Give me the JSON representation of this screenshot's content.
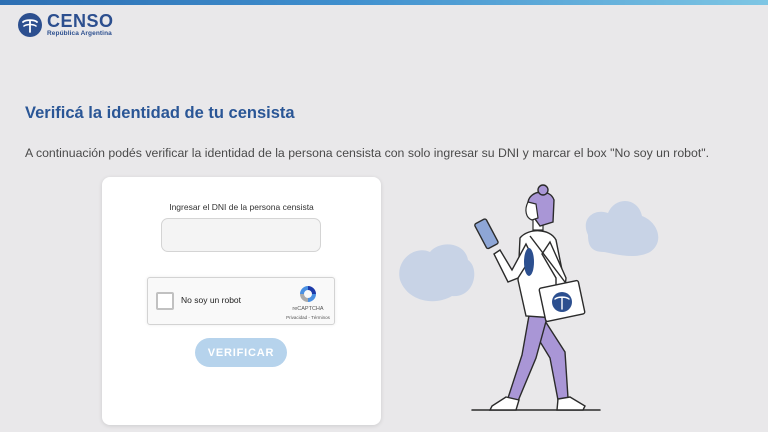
{
  "brand": {
    "name": "CENSO",
    "subtitle": "República Argentina",
    "color": "#2c4f8f"
  },
  "page": {
    "title": "Verificá la identidad de tu censista",
    "description": "A continuación podés verificar la identidad de la persona censista con solo ingresar su DNI y marcar el box \"No soy un robot\"."
  },
  "form": {
    "dni_label": "Ingresar el DNI de la persona censista",
    "dni_value": "",
    "recaptcha": {
      "label": "No soy un robot",
      "brand": "reCAPTCHA",
      "privacy": "Privacidad",
      "separator": "-",
      "terms": "Términos",
      "checked": false
    },
    "submit_label": "VERIFICAR",
    "submit_enabled": false
  },
  "colors": {
    "background": "#e9e8ea",
    "title": "#2a5696",
    "button_disabled": "#b6d3ec",
    "illustration_purple": "#a996d6",
    "illustration_blob": "#c8d3e6"
  }
}
